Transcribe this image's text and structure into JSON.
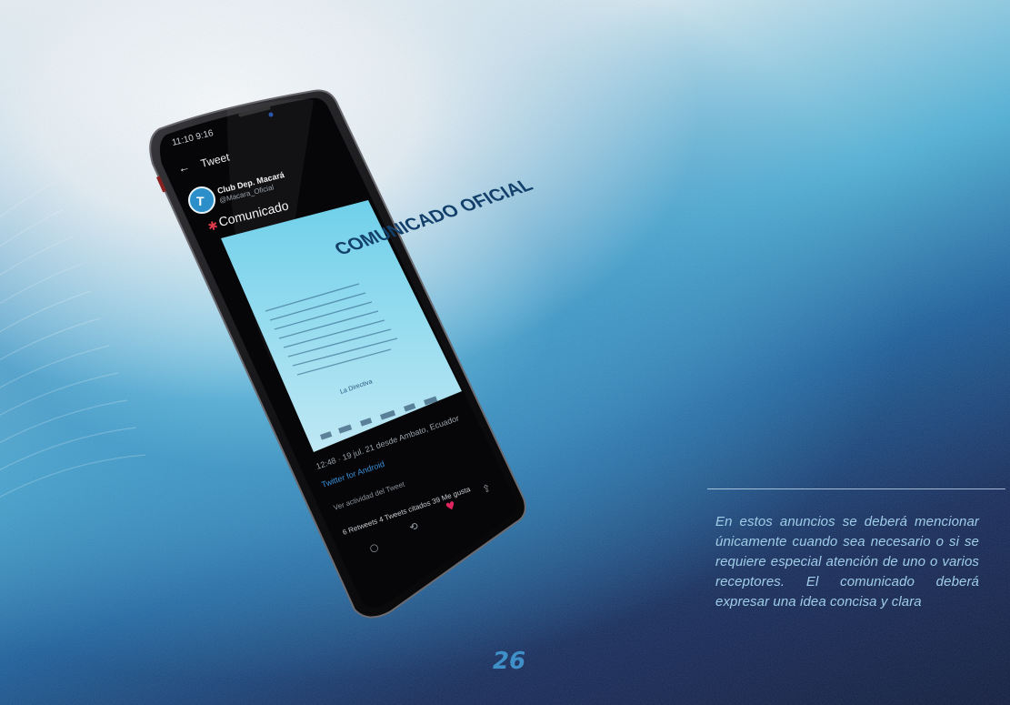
{
  "phone": {
    "status_left": "11:10 9:16",
    "screen_title": "Tweet",
    "account_name": "Club Dep. Macará",
    "account_handle": "@Macara_Oficial",
    "avatar_letter": "T",
    "tweet_text": "Comunicado",
    "poster_title": "COMUNICADO OFICIAL",
    "poster_signature": "La Directiva",
    "timestamp": "12:48 · 19 jul. 21 desde Ambato, Ecuador",
    "source": "Twitter for Android",
    "activity": "Ver actividad del Tweet",
    "stats": "6 Retweets  4 Tweets citados  39 Me gusta"
  },
  "caption": "En estos anuncios se deberá mencionar únicamente cuando sea necesario o si se requiere especial atención de uno o varios receptores. El comunicado deberá expresar una idea concisa y clara",
  "page_number": "26",
  "colors": {
    "caption": "#9fcde6",
    "page_number": "#3f8fc8",
    "poster": "#5bc4e3"
  }
}
